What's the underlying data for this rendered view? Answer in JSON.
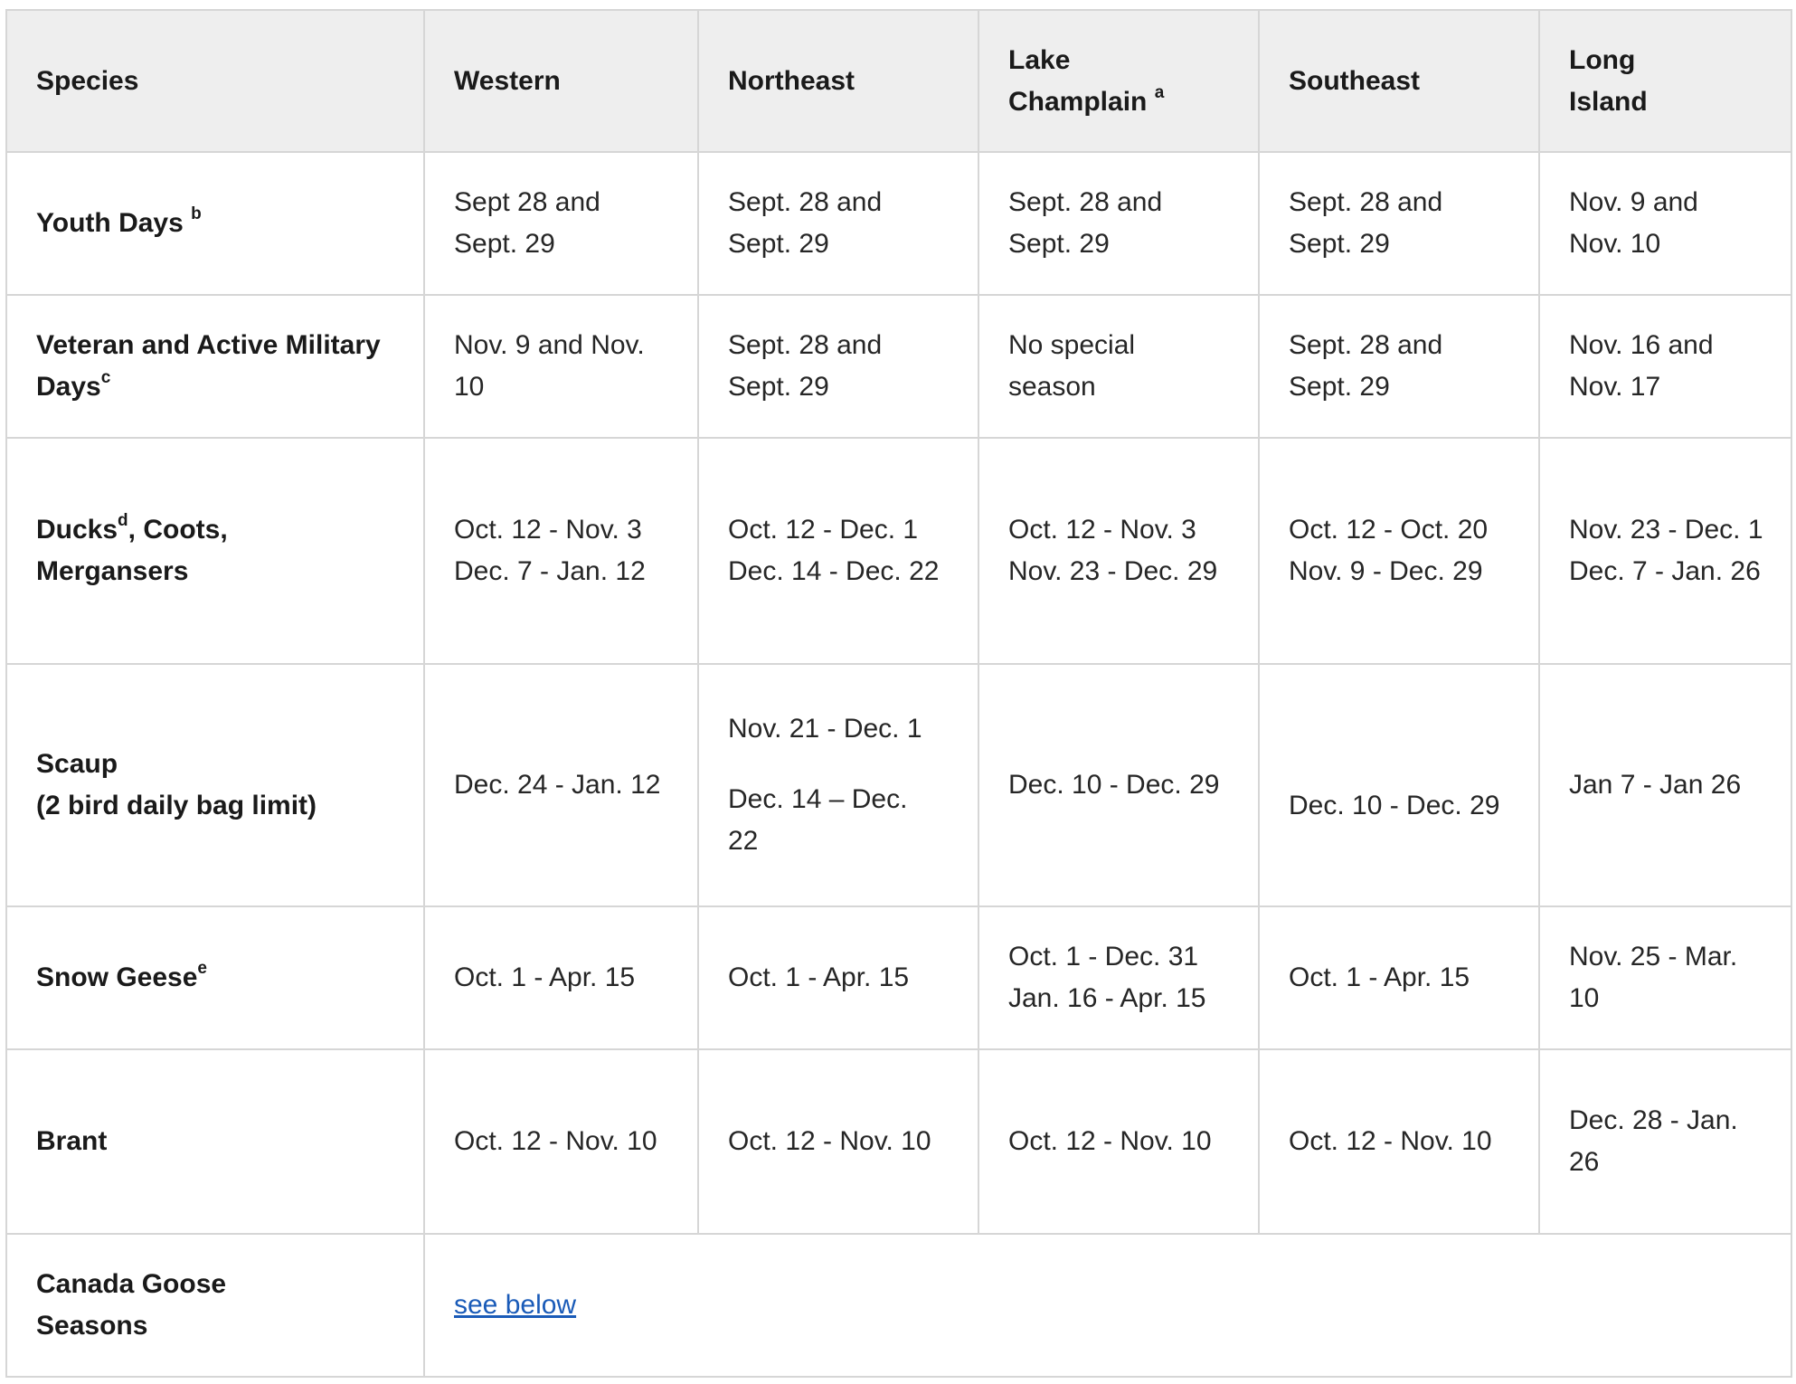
{
  "header": {
    "species": "Species",
    "western": "Western",
    "northeast": "Northeast",
    "lake_champlain": "Lake Champlain",
    "lake_champlain_note": "a",
    "southeast": "Southeast",
    "long_island": "Long Island"
  },
  "rows": [
    {
      "species": "Youth Days",
      "note": "b",
      "western": "Sept 28 and Sept. 29",
      "northeast": "Sept. 28 and Sept. 29",
      "lake_champlain": "Sept. 28 and Sept. 29",
      "southeast": "Sept. 28 and Sept. 29",
      "long_island": "Nov. 9 and Nov. 10"
    },
    {
      "species": "Veteran and Active Military Days",
      "note": "c",
      "western": "Nov. 9 and Nov. 10",
      "northeast": "Sept. 28 and Sept. 29",
      "lake_champlain": "No special season",
      "southeast": "Sept. 28 and Sept. 29",
      "long_island": "Nov. 16 and Nov. 17"
    },
    {
      "species_a": "Ducks",
      "note": "d",
      "species_b": ", Coots, Mergansers",
      "western": [
        "Oct. 12 - Nov. 3",
        "Dec. 7 - Jan. 12"
      ],
      "northeast": [
        "Oct. 12 - Dec. 1",
        "Dec. 14 - Dec. 22"
      ],
      "lake_champlain": [
        "Oct. 12 - Nov. 3",
        "Nov. 23 - Dec. 29"
      ],
      "southeast": [
        "Oct. 12 - Oct. 20",
        "Nov. 9 - Dec. 29"
      ],
      "long_island": [
        "Nov. 23 - Dec. 1",
        "Dec. 7 - Jan. 26"
      ]
    },
    {
      "species": "Scaup",
      "species_sub": "(2 bird daily bag limit)",
      "western": "Dec. 24 - Jan. 12",
      "northeast": [
        "Nov. 21 - Dec. 1",
        "Dec. 14 – Dec. 22"
      ],
      "lake_champlain": "Dec. 10 - Dec. 29",
      "southeast": "Dec. 10 - Dec. 29",
      "long_island": "Jan 7 - Jan 26"
    },
    {
      "species": "Snow Geese",
      "note": "e",
      "western": "Oct. 1 - Apr. 15",
      "northeast": "Oct. 1 - Apr. 15",
      "lake_champlain": [
        "Oct. 1 - Dec. 31",
        "Jan. 16 - Apr. 15"
      ],
      "southeast": "Oct. 1 - Apr. 15",
      "long_island": "Nov. 25 - Mar. 10"
    },
    {
      "species": "Brant",
      "western": "Oct. 12 - Nov. 10",
      "northeast": "Oct. 12 - Nov. 10",
      "lake_champlain": "Oct. 12 - Nov. 10",
      "southeast": "Oct. 12 - Nov. 10",
      "long_island": "Dec. 28 - Jan. 26"
    },
    {
      "species": "Canada Goose Seasons",
      "link": "see below"
    }
  ]
}
